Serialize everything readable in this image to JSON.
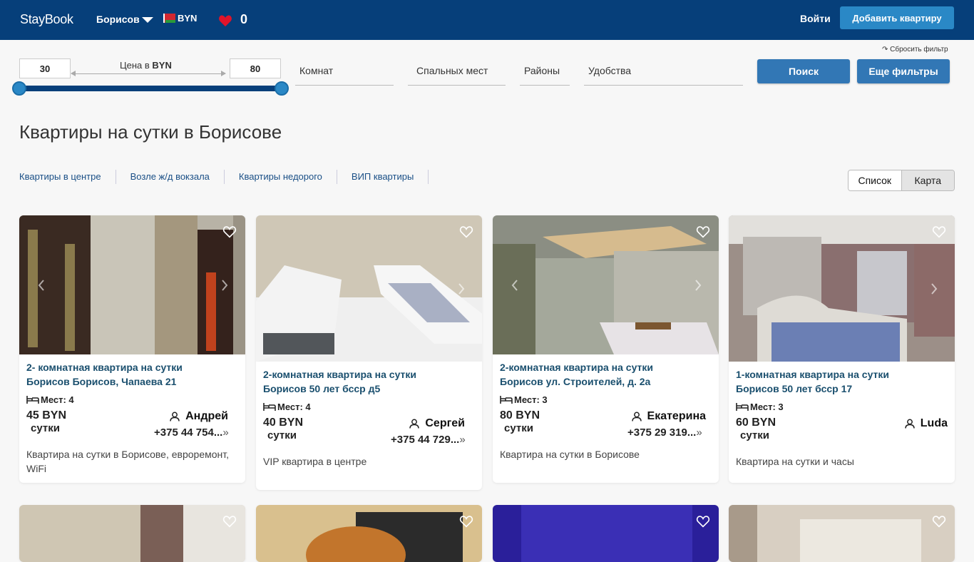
{
  "header": {
    "logo": "StayBook",
    "city": "Борисов",
    "currency": "BYN",
    "favorites_count": "0",
    "login": "Войти",
    "add_apartment": "Добавить квартиру",
    "colors": {
      "bar": "#063f7a",
      "button": "#2a88c6",
      "heart": "#e0142a"
    }
  },
  "filters": {
    "reset": "↷ Сбросить фильтр",
    "price_min": "30",
    "price_max": "80",
    "price_label_prefix": "Цена в ",
    "price_label_currency": "BYN",
    "rooms": "Комнат",
    "sleeping_places": "Спальных мест",
    "districts": "Районы",
    "amenities": "Удобства",
    "search": "Поиск",
    "more_filters": "Еще фильтры"
  },
  "page_title": "Квартиры на сутки в Борисове",
  "quick_links": [
    "Квартиры в центре",
    "Возле ж/д вокзала",
    "Квартиры недорого",
    "ВИП квартиры"
  ],
  "view_toggle": {
    "list": "Список",
    "map": "Карта",
    "active": "list"
  },
  "listings": [
    {
      "title_line1": "2- комнатная квартира на сутки",
      "title_line2": "Борисов Борисов, Чапаева 21",
      "places": "Мест: 4",
      "price": "45 BYN",
      "per": "сутки",
      "owner": "Андрей",
      "phone": "+375 44 754...",
      "description": "Квартира на сутки в Борисове, евроремонт, WiFi"
    },
    {
      "title_line1": "2-комнатная квартира на сутки",
      "title_line2": "Борисов 50 лет бсср д5",
      "places": "Мест: 4",
      "price": "40 BYN",
      "per": "сутки",
      "owner": "Сергей",
      "phone": "+375 44 729...",
      "description": "VIP квартира в центре"
    },
    {
      "title_line1": "2-комнатная квартира на сутки",
      "title_line2": "Борисов ул. Строителей, д. 2а",
      "places": "Мест: 3",
      "price": "80 BYN",
      "per": "сутки",
      "owner": "Екатерина",
      "phone": "+375 29 319...",
      "description": "Квартира на сутки в Борисове"
    },
    {
      "title_line1": "1-комнатная квартира на сутки",
      "title_line2": "Борисов 50 лет бсср 17",
      "places": "Мест: 3",
      "price": "60 BYN",
      "per": "сутки",
      "owner": "Luda",
      "phone": "",
      "description": "Квартира на сутки и часы"
    }
  ]
}
